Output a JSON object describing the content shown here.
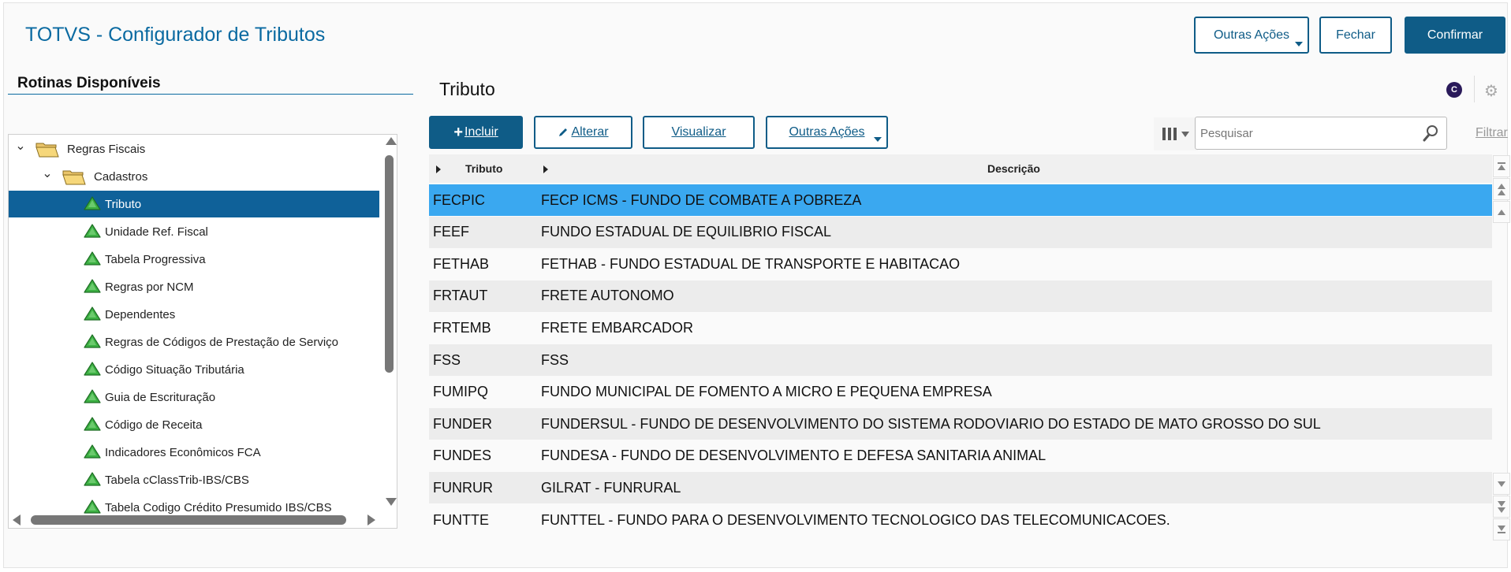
{
  "app": {
    "title": "TOTVS - Configurador de Tributos"
  },
  "header_buttons": {
    "outras_acoes": "Outras Ações",
    "fechar": "Fechar",
    "confirmar": "Confirmar"
  },
  "left_panel": {
    "heading": "Rotinas Disponíveis",
    "tree": [
      {
        "label": "Regras Fiscais",
        "level": 0,
        "type": "folder",
        "expanded": true
      },
      {
        "label": "Cadastros",
        "level": 1,
        "type": "folder",
        "expanded": true
      },
      {
        "label": "Tributo",
        "level": 2,
        "type": "item",
        "selected": true
      },
      {
        "label": "Unidade Ref. Fiscal",
        "level": 2,
        "type": "item"
      },
      {
        "label": "Tabela Progressiva",
        "level": 2,
        "type": "item"
      },
      {
        "label": "Regras por NCM",
        "level": 2,
        "type": "item"
      },
      {
        "label": "Dependentes",
        "level": 2,
        "type": "item"
      },
      {
        "label": "Regras de Códigos de Prestação de Serviço",
        "level": 2,
        "type": "item"
      },
      {
        "label": "Código Situação Tributária",
        "level": 2,
        "type": "item"
      },
      {
        "label": "Guia de Escrituração",
        "level": 2,
        "type": "item"
      },
      {
        "label": "Código de Receita",
        "level": 2,
        "type": "item"
      },
      {
        "label": "Indicadores Econômicos FCA",
        "level": 2,
        "type": "item"
      },
      {
        "label": "Tabela cClassTrib-IBS/CBS",
        "level": 2,
        "type": "item"
      },
      {
        "label": "Tabela Codigo Crédito Presumido IBS/CBS",
        "level": 2,
        "type": "item"
      }
    ]
  },
  "main": {
    "title": "Tributo",
    "badge": "C",
    "toolbar": {
      "incluir": "Incluir",
      "alterar": "Alterar",
      "visualizar": "Visualizar",
      "outras_acoes": "Outras Ações"
    },
    "search": {
      "placeholder": "Pesquisar"
    },
    "filter_label": "Filtrar",
    "grid": {
      "columns": [
        "Tributo",
        "Descrição"
      ],
      "rows": [
        {
          "code": "FECPIC",
          "desc": "FECP ICMS - FUNDO DE COMBATE A POBREZA",
          "selected": true
        },
        {
          "code": "FEEF",
          "desc": "FUNDO ESTADUAL DE EQUILIBRIO FISCAL"
        },
        {
          "code": "FETHAB",
          "desc": "FETHAB - FUNDO ESTADUAL DE TRANSPORTE E HABITACAO"
        },
        {
          "code": "FRTAUT",
          "desc": "FRETE AUTONOMO"
        },
        {
          "code": "FRTEMB",
          "desc": "FRETE EMBARCADOR"
        },
        {
          "code": "FSS",
          "desc": "FSS"
        },
        {
          "code": "FUMIPQ",
          "desc": "FUNDO MUNICIPAL DE FOMENTO A MICRO E PEQUENA EMPRESA"
        },
        {
          "code": "FUNDER",
          "desc": "FUNDERSUL - FUNDO DE DESENVOLVIMENTO DO SISTEMA RODOVIARIO DO ESTADO DE MATO GROSSO DO SUL"
        },
        {
          "code": "FUNDES",
          "desc": "FUNDESA - FUNDO DE DESENVOLVIMENTO E DEFESA SANITARIA ANIMAL"
        },
        {
          "code": "FUNRUR",
          "desc": "GILRAT - FUNRURAL"
        },
        {
          "code": "FUNTTE",
          "desc": "FUNTTEL - FUNDO PARA O DESENVOLVIMENTO TECNOLOGICO DAS TELECOMUNICACOES."
        }
      ]
    }
  },
  "colors": {
    "brand": "#0a6aa1",
    "primary_button": "#0f5c87",
    "tree_selected": "#0f6199",
    "grid_selected": "#3aa8f0"
  },
  "icons": {
    "folder": "folder-open-icon",
    "item": "green-triangle-icon",
    "add": "plus-icon",
    "edit": "pencil-icon",
    "search": "magnifier-icon",
    "settings": "gear-icon",
    "columns": "columns-icon"
  }
}
